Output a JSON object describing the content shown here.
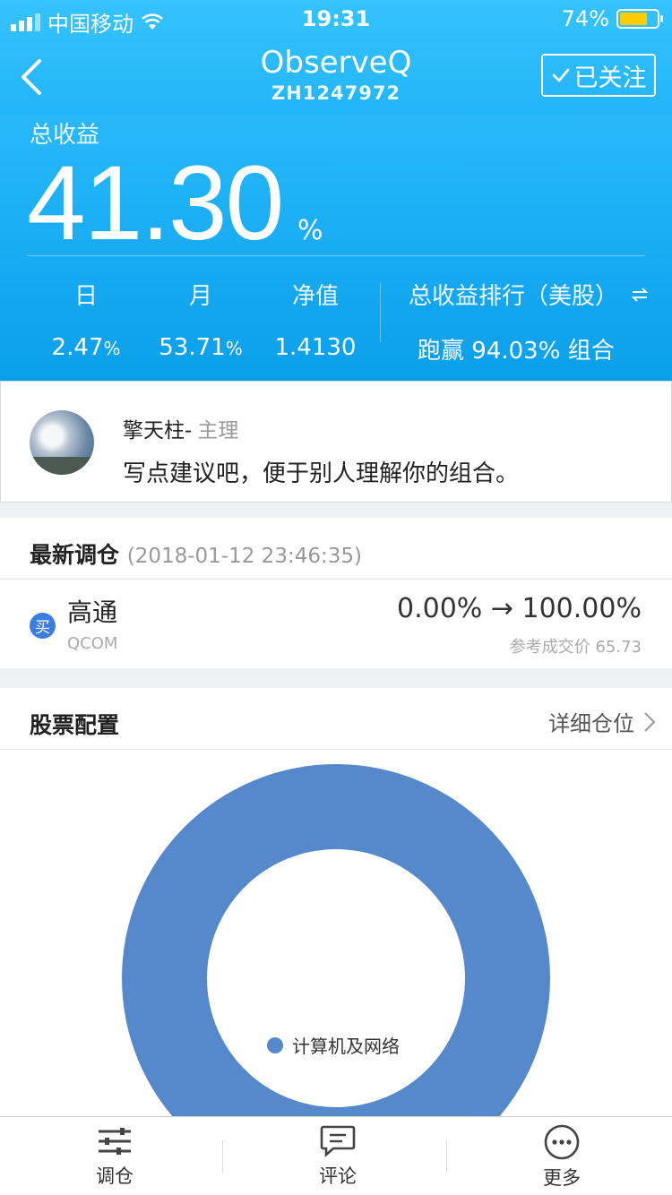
{
  "status_bar": {
    "carrier": "中国移动",
    "time": "19:31",
    "battery": "74%",
    "battery_level": 0.74,
    "battery_color": "#ffcc00"
  },
  "nav": {
    "title": "ObserveQ",
    "subtitle": "ZH1247972",
    "follow_label": "已关注"
  },
  "returns": {
    "total_label": "总收益",
    "total_value": "41.30",
    "total_unit": "%",
    "day_label": "日",
    "day_value": "2.47",
    "day_unit": "%",
    "month_label": "月",
    "month_value": "53.71",
    "month_unit": "%",
    "nav_label": "净值",
    "nav_value": "1.4130",
    "rank_label": "总收益排行（美股）",
    "rank_prefix": "跑赢",
    "rank_value": "94.03%",
    "rank_suffix": "组合"
  },
  "manager": {
    "name": "擎天柱-",
    "role": "主理",
    "description": "写点建议吧，便于别人理解你的组合。"
  },
  "rebalance": {
    "title": "最新调仓",
    "timestamp": "(2018-01-12 23:46:35)",
    "action": "买",
    "stock_name": "高通",
    "stock_code": "QCOM",
    "weights": "0.00% → 100.00%",
    "ref_price": "参考成交价 65.73"
  },
  "allocation": {
    "title": "股票配置",
    "link": "详细仓位"
  },
  "chart_data": {
    "type": "pie",
    "categories": [
      "计算机及网络"
    ],
    "values": [
      100
    ],
    "colors": [
      "#5688cc"
    ],
    "legend_placement": "center"
  },
  "tabbar": {
    "tabs": [
      {
        "label": "调仓"
      },
      {
        "label": "评论"
      },
      {
        "label": "更多"
      }
    ]
  },
  "colors": {
    "accent": "#19aef5",
    "buy_badge": "#3b7de0"
  }
}
